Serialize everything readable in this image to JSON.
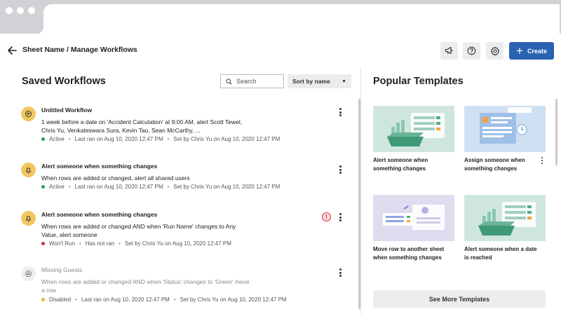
{
  "header": {
    "breadcrumb": "Sheet Name / Manage Workflows",
    "create_label": "Create",
    "icons": [
      "back-arrow-icon",
      "megaphone-icon",
      "help-icon",
      "gear-icon"
    ]
  },
  "saved": {
    "title": "Saved Workflows",
    "search_placeholder": "Search",
    "sort_label": "Sort by name",
    "workflows": [
      {
        "title": "Untitled Workflow",
        "desc": "1 week before a date on 'Accident Calculation' at 9:00 AM, alert Scott Tewel, Chris Yu, Venkateswara Sura, Kevin Tao, Sean McCarthy, ...",
        "status": "Active",
        "status_color": "#2e9e55",
        "last_ran": "Last ran on Aug 10, 2020 12:47 PM",
        "set_by": "Set by Chris Yu on Aug 10, 2020 12:47 PM",
        "icon": "workflow-icon"
      },
      {
        "title": "Alert someone when something changes",
        "desc": "When rows are added or changed, alert all shared users",
        "status": "Active",
        "status_color": "#2e9e55",
        "last_ran": "Last ran on Aug 10, 2020 12:47 PM",
        "set_by": "Set by Chris Yu on Aug 10, 2020 12:47 PM",
        "icon": "bell-icon"
      },
      {
        "title": "Alert someone when something changes",
        "desc": "When rows are added or changed AND when 'Run Name' changes to Any Value, alert someone",
        "status": "Won't Run",
        "status_color": "#c8323c",
        "last_ran": "Has not ran",
        "set_by": "Set by Chris Yu on Aug 10, 2020 12:47 PM",
        "icon": "bell-icon",
        "warning": "!"
      },
      {
        "title": "Missing Guests",
        "desc": "When rows are added or changed AND when 'Status' changes to 'Green' move a row",
        "status": "Disabled",
        "status_color": "#e2b93b",
        "last_ran": "Last ran on Aug 10, 2020 12:47 PM",
        "set_by": "Set by Chris Yu on Aug 10, 2020 12:47 PM",
        "icon": "move-row-icon"
      }
    ]
  },
  "templates": {
    "title": "Popular Templates",
    "cards": [
      {
        "label": "Alert someone when something changes",
        "bg": "#cfe6df"
      },
      {
        "label": "Assign someone when something changes",
        "bg": "#cfe0f3"
      },
      {
        "label": "Move row to another sheet when something changes",
        "bg": "#e0dcf0"
      },
      {
        "label": "Alert someone when a date is reached",
        "bg": "#cfe6df"
      }
    ],
    "see_more": "See More Templates"
  },
  "colors": {
    "accent": "#2b63b3",
    "warning_yellow": "#f0c75e"
  }
}
